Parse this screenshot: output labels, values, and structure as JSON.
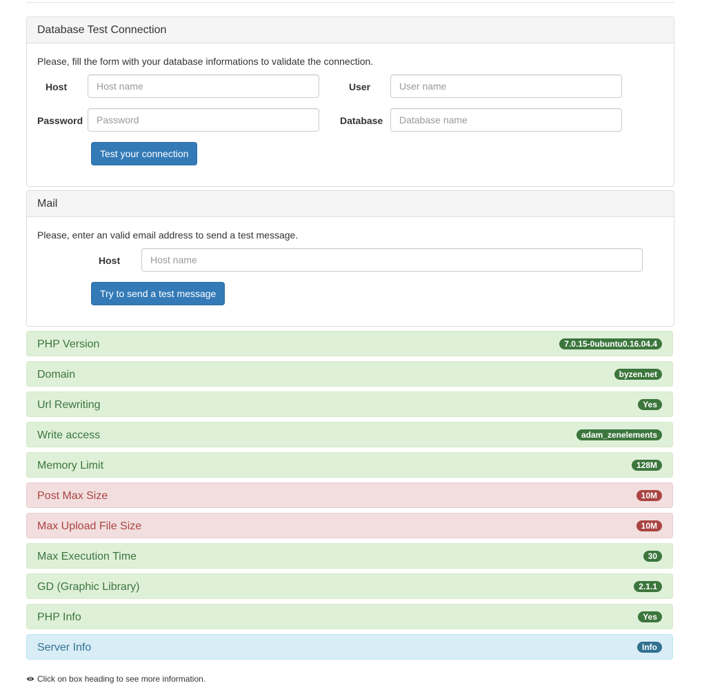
{
  "db_panel": {
    "title": "Database Test Connection",
    "description": "Please, fill the form with your database informations to validate the connection.",
    "host_label": "Host",
    "host_placeholder": "Host name",
    "user_label": "User",
    "user_placeholder": "User name",
    "password_label": "Password",
    "password_placeholder": "Password",
    "database_label": "Database",
    "database_placeholder": "Database name",
    "button_label": "Test your connection"
  },
  "mail_panel": {
    "title": "Mail",
    "description": "Please, enter an valid email address to send a test message.",
    "host_label": "Host",
    "host_placeholder": "Host name",
    "button_label": "Try to send a test message"
  },
  "checks": [
    {
      "label": "PHP Version",
      "value": "7.0.15-0ubuntu0.16.04.4",
      "status": "success"
    },
    {
      "label": "Domain",
      "value": "byzen.net",
      "status": "success"
    },
    {
      "label": "Url Rewriting",
      "value": "Yes",
      "status": "success"
    },
    {
      "label": "Write access",
      "value": "adam_zenelements",
      "status": "success"
    },
    {
      "label": "Memory Limit",
      "value": "128M",
      "status": "success"
    },
    {
      "label": "Post Max Size",
      "value": "10M",
      "status": "danger"
    },
    {
      "label": "Max Upload File Size",
      "value": "10M",
      "status": "danger"
    },
    {
      "label": "Max Execution Time",
      "value": "30",
      "status": "success"
    },
    {
      "label": "GD (Graphic Library)",
      "value": "2.1.1",
      "status": "success"
    },
    {
      "label": "PHP Info",
      "value": "Yes",
      "status": "success"
    },
    {
      "label": "Server Info",
      "value": "Info",
      "status": "info"
    }
  ],
  "colors": {
    "success": "#3c763d",
    "danger": "#a94442",
    "info": "#31708f",
    "primary": "#337ab7"
  },
  "footer": {
    "icon": "eye-icon",
    "text": "Click on box heading to see more information."
  }
}
